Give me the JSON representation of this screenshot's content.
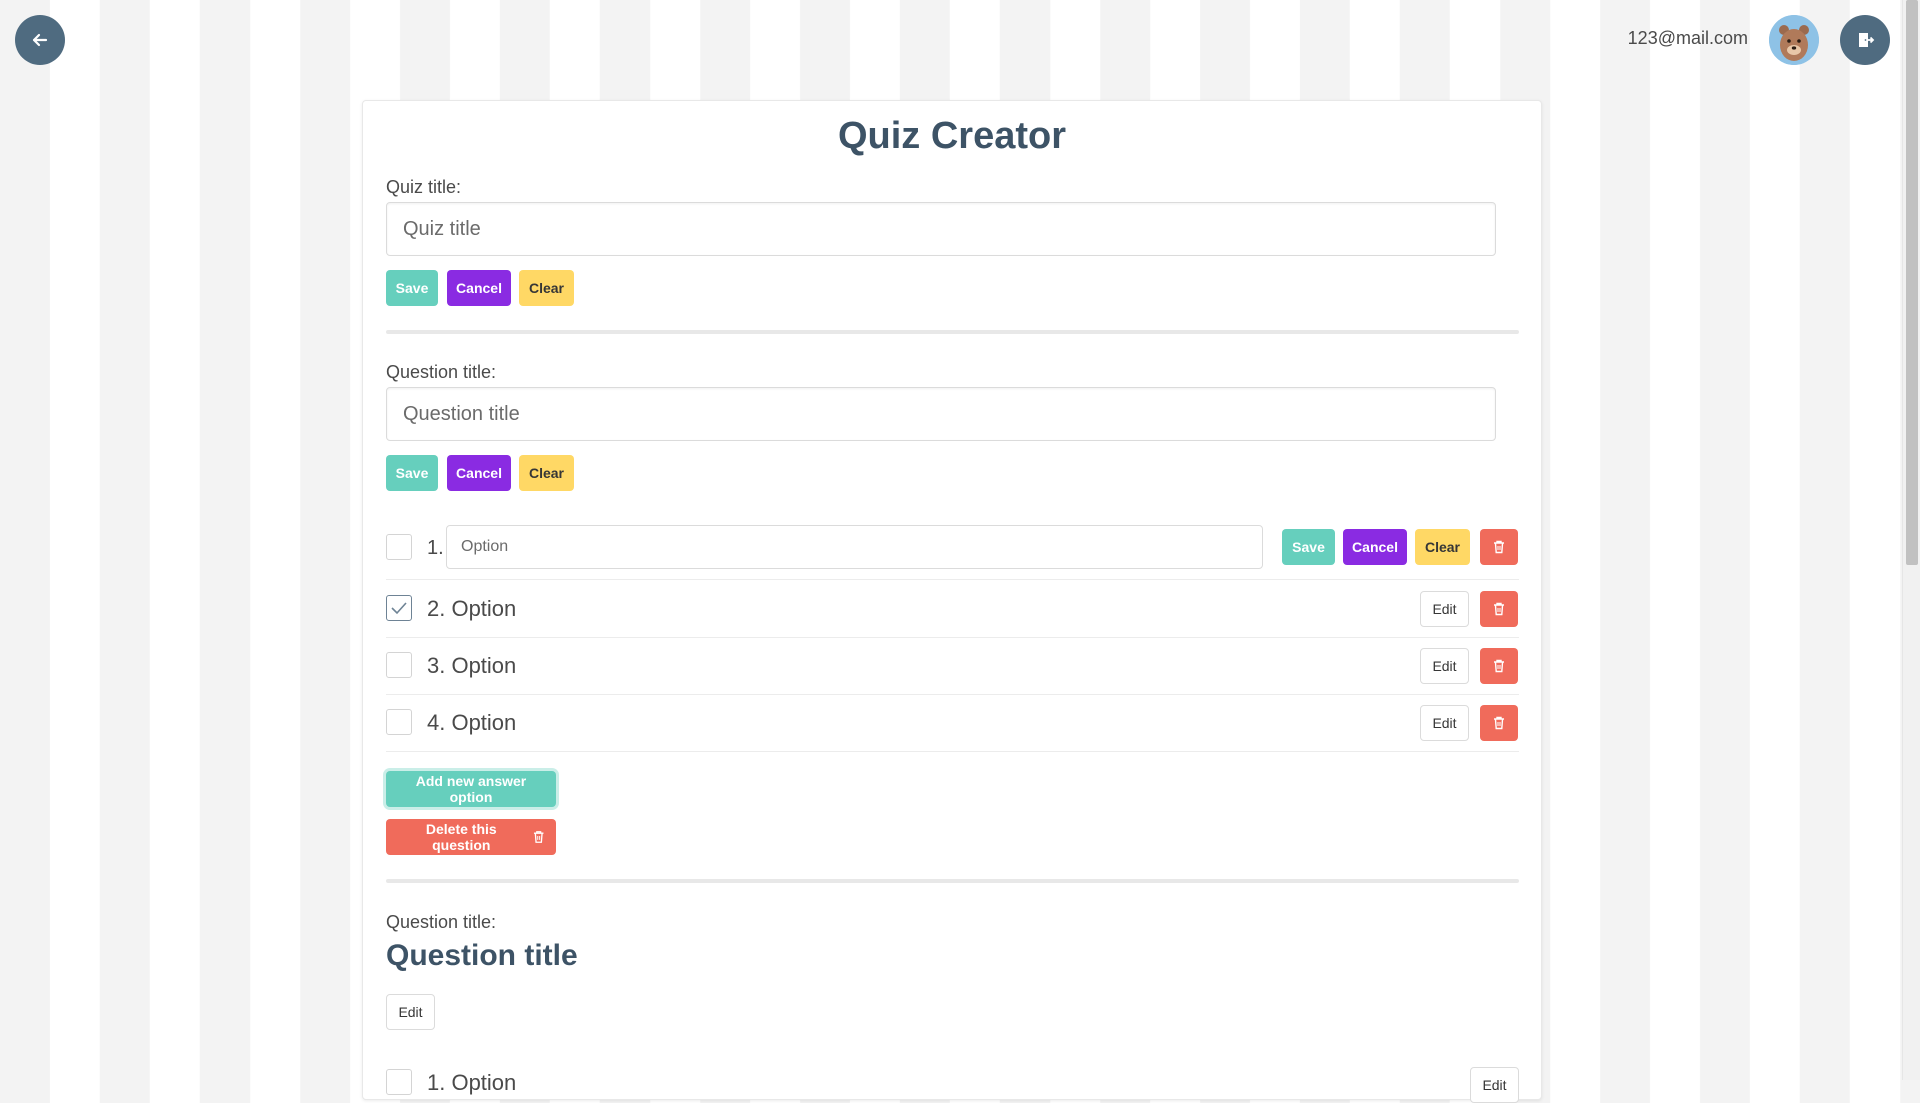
{
  "header": {
    "email": "123@mail.com"
  },
  "page": {
    "title": "Quiz Creator"
  },
  "quiz": {
    "title_label": "Quiz title:",
    "title_placeholder": "Quiz title",
    "save": "Save",
    "cancel": "Cancel",
    "clear": "Clear"
  },
  "question1": {
    "title_label": "Question title:",
    "title_placeholder": "Question title",
    "save": "Save",
    "cancel": "Cancel",
    "clear": "Clear",
    "editing_option": {
      "number": "1.",
      "placeholder": "Option",
      "save": "Save",
      "cancel": "Cancel",
      "clear": "Clear"
    },
    "options": [
      {
        "text": "2. Option",
        "checked": true,
        "edit": "Edit"
      },
      {
        "text": "3. Option",
        "checked": false,
        "edit": "Edit"
      },
      {
        "text": "4. Option",
        "checked": false,
        "edit": "Edit"
      }
    ],
    "add_option": "Add new answer option",
    "delete_question": "Delete this question"
  },
  "question2": {
    "title_label": "Question title:",
    "title": "Question title",
    "edit": "Edit",
    "first_option": {
      "text": "1. Option",
      "edit": "Edit"
    }
  },
  "colors": {
    "save": "#66cfbd",
    "cancel": "#8a2be2",
    "clear": "#ffd865",
    "danger": "#f06b5b",
    "header_icon_bg": "#4f6b80"
  }
}
